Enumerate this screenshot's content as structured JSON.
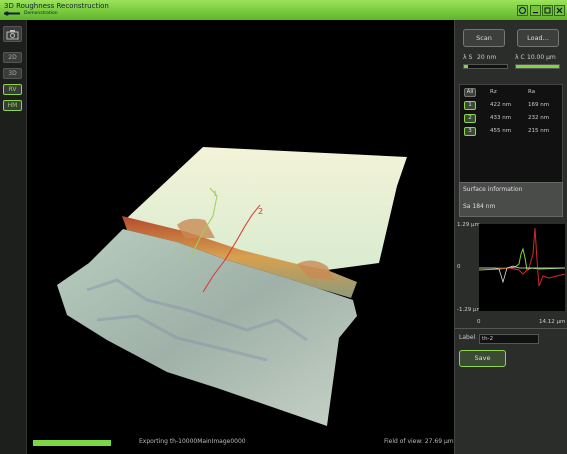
{
  "window": {
    "title": "3D Roughness Reconstruction",
    "subtitle": "Demonstration",
    "buttons": [
      "minimize-button",
      "maximize-button",
      "close-button"
    ]
  },
  "leftbar": {
    "buttons": [
      {
        "id": "2d",
        "label": "2D",
        "active": false
      },
      {
        "id": "3d",
        "label": "3D",
        "active": false
      },
      {
        "id": "rv",
        "label": "RV",
        "active": true
      },
      {
        "id": "hm",
        "label": "HM",
        "active": true
      }
    ]
  },
  "viewport": {
    "markers": [
      {
        "label": "1",
        "color": "#9ed05a"
      },
      {
        "label": "2",
        "color": "#e03030"
      }
    ],
    "status_text": "Exporting th-10000MainImage0000",
    "progress": 1.0,
    "field_of_view": "Field of view: 27.69 µm"
  },
  "panel": {
    "scan_label": "Scan",
    "load_label": "Load...",
    "lambda_s_label": "λ S",
    "lambda_s_value": "20 nm",
    "lambda_c_label": "λ C",
    "lambda_c_value": "10.00 µm",
    "lambda_s_level": 0.1,
    "lambda_c_level": 1.0,
    "results": {
      "all_label": "All",
      "col_rz": "Rz",
      "col_ra": "Ra",
      "rows": [
        {
          "id": "1",
          "rz": "422 nm",
          "ra": "169 nm"
        },
        {
          "id": "2",
          "rz": "433 nm",
          "ra": "232 nm"
        },
        {
          "id": "3",
          "rz": "455 nm",
          "ra": "215 nm"
        }
      ]
    },
    "surface": {
      "title": "Surface information",
      "value": "Sa 184 nm"
    },
    "profile": {
      "y_max": "1.29 µm",
      "y_mid": "0",
      "y_min": "-1.29 µm",
      "x_min": "0",
      "x_max": "14.12 µm",
      "colors": {
        "green": "#7fd645",
        "red": "#d12a2a",
        "white": "#dddddd"
      }
    },
    "label_caption": "Label",
    "label_value": "th-2",
    "save_label": "Save"
  },
  "colors": {
    "accent": "#7fd645"
  }
}
